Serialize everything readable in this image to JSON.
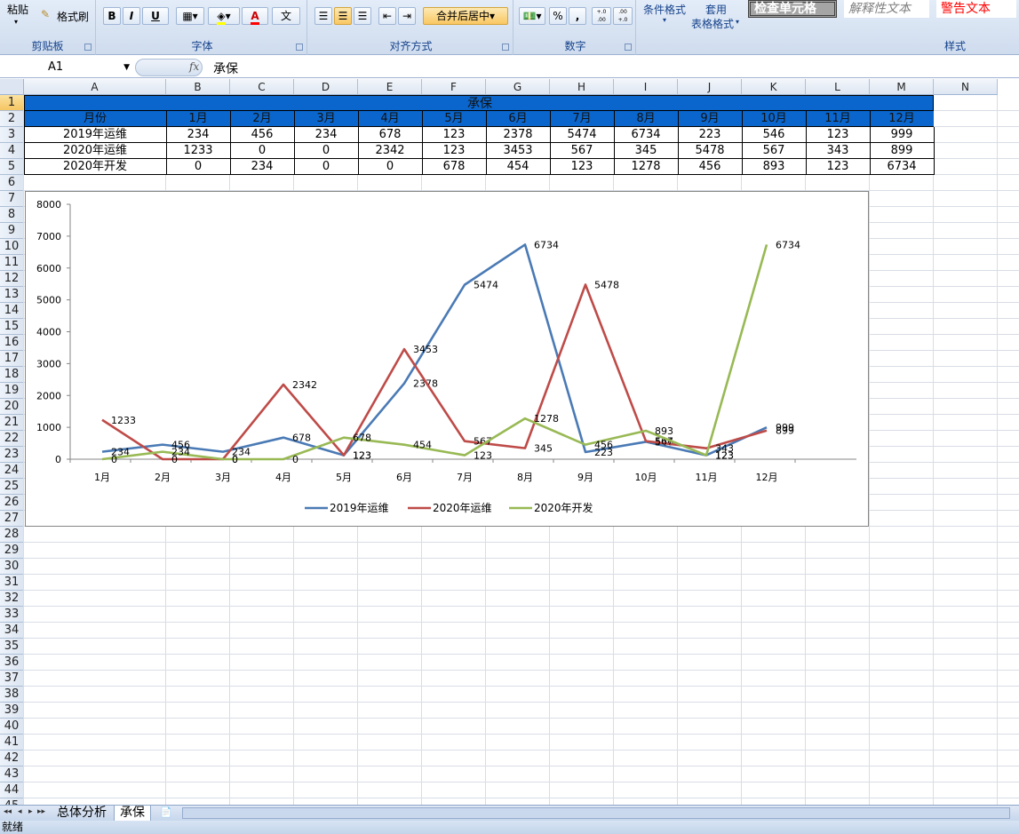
{
  "ribbon": {
    "clipboard": {
      "paste": "粘贴",
      "format_painter": "格式刷",
      "title": "剪贴板"
    },
    "font": {
      "bold": "B",
      "italic": "I",
      "underline": "U",
      "font_color_glyph": "A",
      "phonetic": "文",
      "title": "字体"
    },
    "alignment": {
      "merge_center": "合并后居中",
      "title": "对齐方式"
    },
    "number": {
      "percent": "%",
      "comma": ",",
      "inc_decimal": "+.0 .00",
      "dec_decimal": ".00 +.0",
      "title": "数字"
    },
    "styles": {
      "conditional": "条件格式",
      "table_format_1": "套用",
      "table_format_2": "表格格式",
      "check_cell": "检查单元格",
      "explanatory": "解释性文本",
      "warning": "警告文本",
      "title": "样式"
    }
  },
  "formula_bar": {
    "name_box": "A1",
    "fx": "fx",
    "content": "承保"
  },
  "columns": [
    "A",
    "B",
    "C",
    "D",
    "E",
    "F",
    "G",
    "H",
    "I",
    "J",
    "K",
    "L",
    "M",
    "N"
  ],
  "rows": [
    "1",
    "2",
    "3",
    "4",
    "5",
    "6",
    "7",
    "8",
    "9",
    "10",
    "11",
    "12",
    "13",
    "14",
    "15",
    "16",
    "17",
    "18",
    "19",
    "20",
    "21",
    "22",
    "23",
    "24",
    "25",
    "26",
    "27",
    "28",
    "29",
    "30",
    "31",
    "32",
    "33",
    "34",
    "35",
    "36",
    "37",
    "38",
    "39",
    "40",
    "41",
    "42",
    "43",
    "44",
    "45"
  ],
  "table": {
    "title": "承保",
    "header": [
      "月份",
      "1月",
      "2月",
      "3月",
      "4月",
      "5月",
      "6月",
      "7月",
      "8月",
      "9月",
      "10月",
      "11月",
      "12月"
    ],
    "body": [
      [
        "2019年运维",
        "234",
        "456",
        "234",
        "678",
        "123",
        "2378",
        "5474",
        "6734",
        "223",
        "546",
        "123",
        "999"
      ],
      [
        "2020年运维",
        "1233",
        "0",
        "0",
        "2342",
        "123",
        "3453",
        "567",
        "345",
        "5478",
        "567",
        "343",
        "899"
      ],
      [
        "2020年开发",
        "0",
        "234",
        "0",
        "0",
        "678",
        "454",
        "123",
        "1278",
        "456",
        "893",
        "123",
        "6734"
      ]
    ]
  },
  "chart_data": {
    "type": "line",
    "categories": [
      "1月",
      "2月",
      "3月",
      "4月",
      "5月",
      "6月",
      "7月",
      "8月",
      "9月",
      "10月",
      "11月",
      "12月"
    ],
    "series": [
      {
        "name": "2019年运维",
        "color": "#4a7ab5",
        "values": [
          234,
          456,
          234,
          678,
          123,
          2378,
          5474,
          6734,
          223,
          546,
          123,
          999
        ]
      },
      {
        "name": "2020年运维",
        "color": "#be4b48",
        "values": [
          1233,
          0,
          0,
          2342,
          123,
          3453,
          567,
          345,
          5478,
          567,
          343,
          899
        ]
      },
      {
        "name": "2020年开发",
        "color": "#98b954",
        "values": [
          0,
          234,
          0,
          0,
          678,
          454,
          123,
          1278,
          456,
          893,
          123,
          6734
        ]
      }
    ],
    "ylim": [
      0,
      8000
    ],
    "yticks": [
      "0",
      "1000",
      "2000",
      "3000",
      "4000",
      "5000",
      "6000",
      "7000",
      "8000"
    ],
    "legend_position": "bottom",
    "data_labels": true,
    "grid": false
  },
  "sheet_tabs": [
    "总体分析",
    "承保"
  ],
  "active_tab": "承保",
  "status": "就绪"
}
